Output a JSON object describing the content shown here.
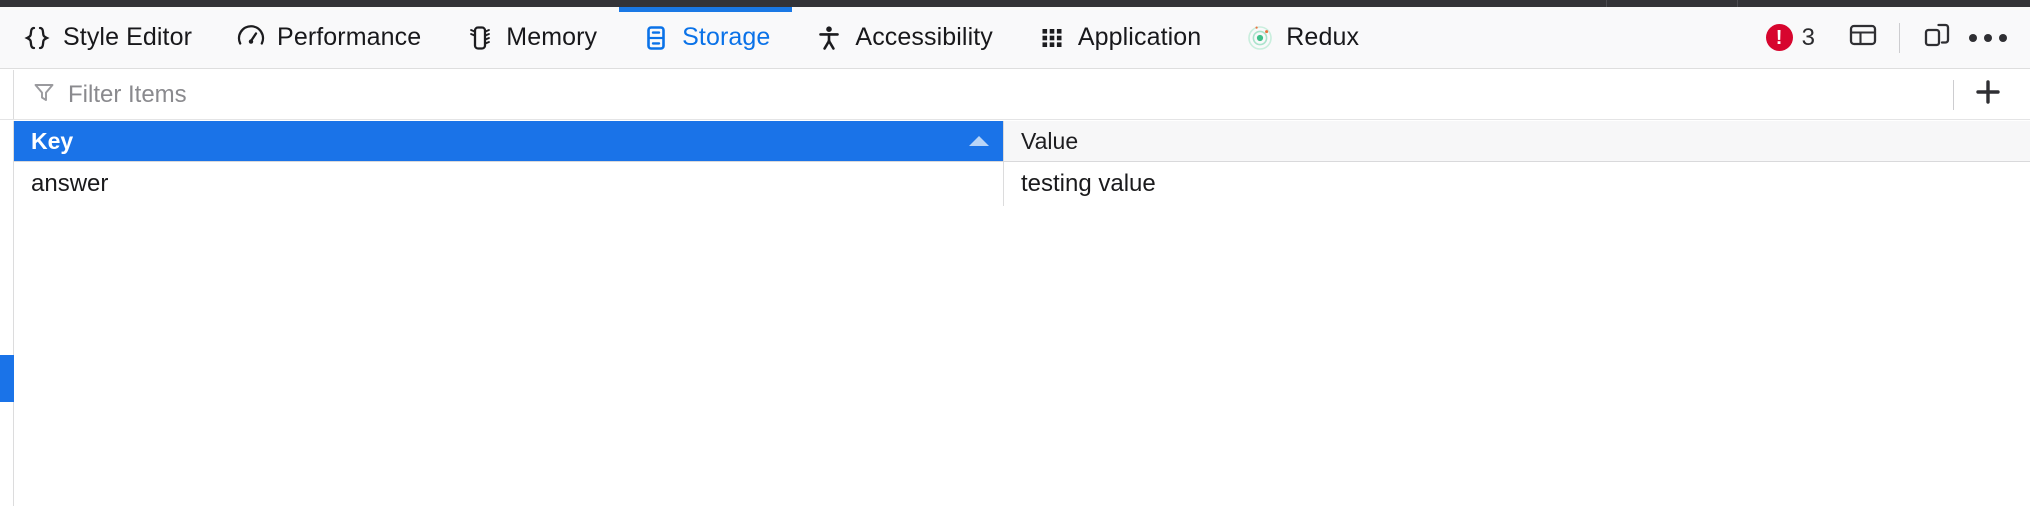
{
  "window": {
    "top_strip_color": "#333338",
    "accent_color": "#1a73e8"
  },
  "toolbar": {
    "tabs": [
      {
        "label": "Style Editor",
        "icon": "braces-icon",
        "active": false
      },
      {
        "label": "Performance",
        "icon": "gauge-icon",
        "active": false
      },
      {
        "label": "Memory",
        "icon": "memory-chip-icon",
        "active": false
      },
      {
        "label": "Storage",
        "icon": "storage-database-icon",
        "active": true
      },
      {
        "label": "Accessibility",
        "icon": "accessibility-person-icon",
        "active": false
      },
      {
        "label": "Application",
        "icon": "application-grid-icon",
        "active": false
      },
      {
        "label": "Redux",
        "icon": "redux-atom-icon",
        "active": false
      }
    ],
    "error_badge": {
      "icon": "error-circle-icon",
      "symbol": "!",
      "count": "3",
      "color": "#d7052e"
    },
    "buttons": [
      {
        "name": "toggle-panel-layout-button",
        "icon": "panel-layout-icon"
      },
      {
        "name": "responsive-design-mode-button",
        "icon": "devices-icon"
      },
      {
        "name": "devtools-more-options-button",
        "icon": "meatball-menu-icon"
      }
    ]
  },
  "filter_bar": {
    "icon": "funnel-filter-icon",
    "placeholder": "Filter Items",
    "value": "",
    "add_item": {
      "name": "add-item-button",
      "icon": "plus-icon",
      "label": "+"
    }
  },
  "table": {
    "columns": [
      {
        "id": "key",
        "label": "Key",
        "sorted": true,
        "sort_direction": "ascending",
        "sort_icon": "sort-ascending-arrow-icon"
      },
      {
        "id": "value",
        "label": "Value",
        "sorted": false
      }
    ],
    "rows": [
      {
        "key": "answer",
        "value": "testing value"
      }
    ]
  },
  "sidebar_splitter": {
    "name": "sidebar-splitter-thumb",
    "color": "#1a73e8"
  }
}
